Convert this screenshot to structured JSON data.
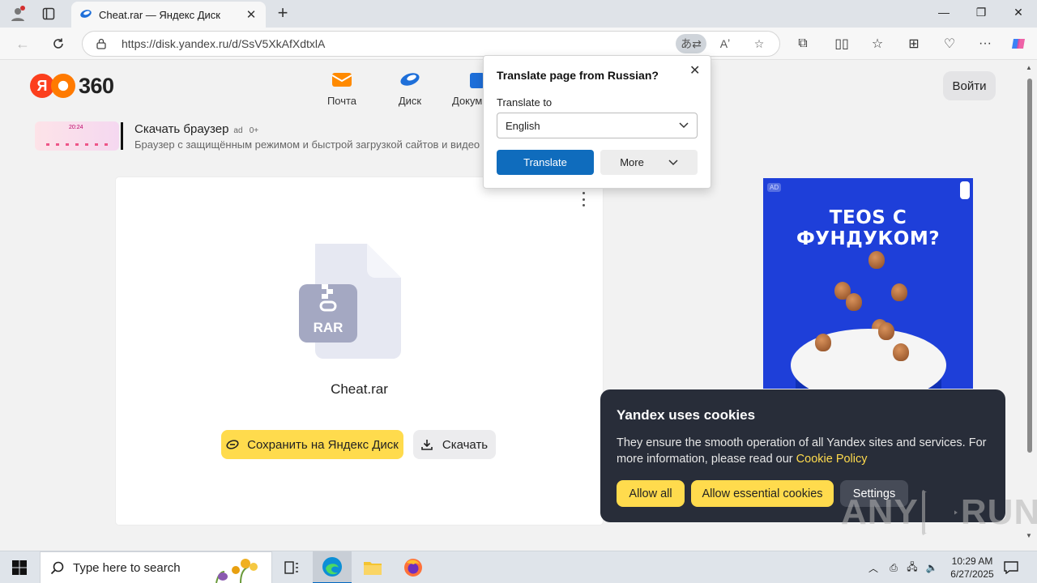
{
  "browser": {
    "tab_title": "Cheat.rar — Яндекс Диск",
    "tab_close": "✕",
    "new_tab": "+",
    "url": "https://disk.yandex.ru/d/SsV5XkAfXdtxlA",
    "window_controls": {
      "minimize": "—",
      "maximize": "❐",
      "close": "✕"
    }
  },
  "header": {
    "logo_letter": "Я",
    "logo_number": "360",
    "services": [
      {
        "label": "Почта",
        "icon": "mail-icon"
      },
      {
        "label": "Диск",
        "icon": "disk-icon"
      },
      {
        "label": "Докум",
        "icon": "docs-icon"
      }
    ],
    "login": "Войти"
  },
  "ad_banner": {
    "title": "Скачать браузер",
    "tag": "ad",
    "age": "0+",
    "subtitle": "Браузер с защищённым режимом и быстрой загрузкой сайтов и видео",
    "thumb_time": "20:24"
  },
  "file": {
    "name": "Cheat.rar",
    "type_label": "RAR",
    "save_button": "Сохранить на Яндекс Диск",
    "download_button": "Скачать"
  },
  "ad_right": {
    "label": "AD",
    "headline": "TEOS С ФУНДУКОМ?",
    "colors": {
      "background": "#1e3fd9"
    }
  },
  "translate_popup": {
    "title": "Translate page from Russian?",
    "translate_to_label": "Translate to",
    "selected_language": "English",
    "translate_button": "Translate",
    "more_button": "More"
  },
  "cookie_banner": {
    "title": "Yandex uses cookies",
    "body": "They ensure the smooth operation of all Yandex sites and services. For more information, please read our ",
    "link": "Cookie Policy",
    "allow_all": "Allow all",
    "allow_essential": "Allow essential cookies",
    "settings": "Settings"
  },
  "watermark": {
    "left": "ANY",
    "right": "RUN"
  },
  "taskbar": {
    "search_placeholder": "Type here to search",
    "time": "10:29 AM",
    "date": "6/27/2025"
  },
  "colors": {
    "accent_yellow": "#ffdb4d",
    "edge_blue": "#0f6cbd",
    "cookie_bg": "#282d39",
    "yandex_red": "#fc3f1d"
  }
}
